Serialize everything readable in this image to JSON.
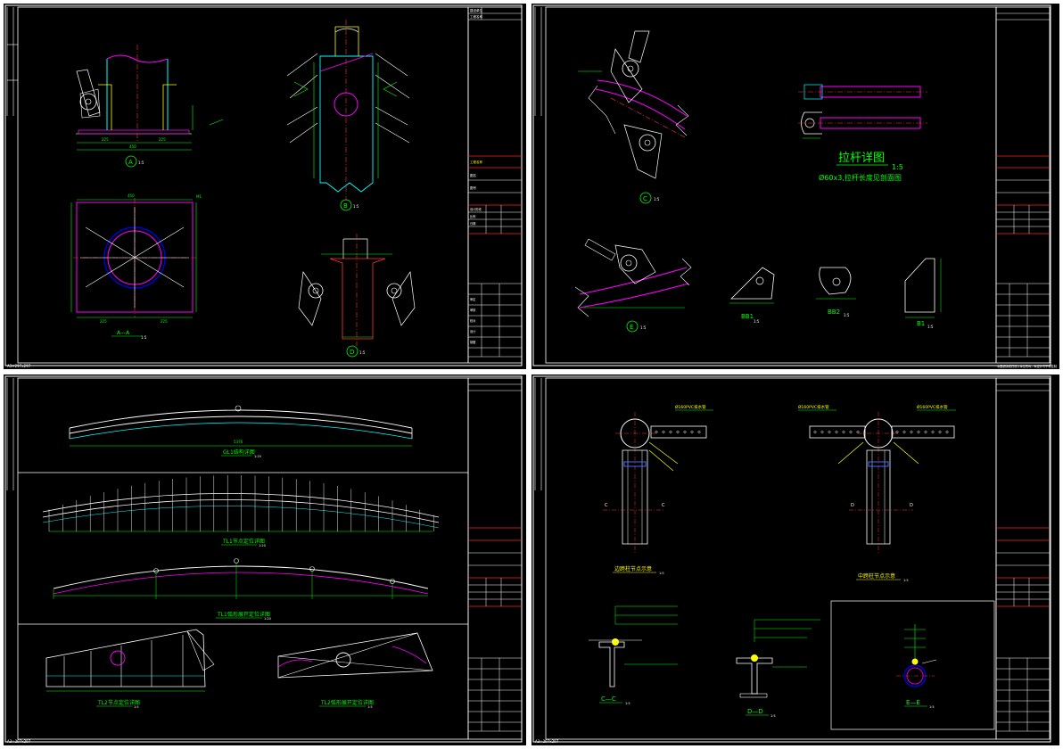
{
  "sheets": [
    {
      "id": "sheet-1",
      "labels": {
        "view_a": "A",
        "view_a_scale": "1:5",
        "view_aa": "A—A",
        "view_aa_scale": "1:5",
        "view_b": "B",
        "view_b_scale": "1:5",
        "view_d": "D",
        "view_d_scale": "1:5",
        "dim_225_left": "225",
        "dim_225_right": "225",
        "dim_450": "450",
        "dim_450_top": "450",
        "plate_m1": "M1"
      }
    },
    {
      "id": "sheet-2",
      "labels": {
        "rod_title": "拉杆详图",
        "rod_scale": "1:5",
        "rod_note": "Ø60x3,拉杆长度见剖面图",
        "view_c": "C",
        "view_c_scale": "1:5",
        "view_e": "E",
        "view_e_scale": "1:5",
        "bb1": "BB1",
        "bb1_scale": "1:5",
        "bb2": "BB2",
        "bb2_scale": "1:5",
        "b1": "B1",
        "b1_scale": "1:5"
      }
    },
    {
      "id": "sheet-3",
      "labels": {
        "gl_title": "GL1结构详图",
        "gl_scale": "1:20",
        "gl_dim": "5376",
        "tl1_title": "TL1节点定位详图",
        "tl1_scale": "1:20",
        "tl1_unfold": "TL1弧形展开定位详图",
        "tl1_unfold_scale": "1:20",
        "tl2_title": "TL2节点定位详图",
        "tl2_scale": "1:5",
        "tl2_unfold": "TL2弧形展开定位详图",
        "tl2_unfold_scale": "1:5"
      }
    },
    {
      "id": "sheet-4",
      "labels": {
        "pvc_left": "Ø160PVC排水管",
        "pvc_right_a": "Ø160PVC排水管",
        "pvc_right_b": "Ø160PVC排水管",
        "left_title": "边跨柱节点示意",
        "left_scale": "1:5",
        "right_title": "中跨柱节点示意",
        "right_scale": "1:5",
        "cc": "C—C",
        "cc_scale": "1:5",
        "dd": "D—D",
        "dd_scale": "1:5",
        "ee": "E—E",
        "ee_scale": "1:5"
      }
    }
  ],
  "title_block": {
    "rows_top": [
      "建设单位",
      "工程名称"
    ],
    "rows_mid": [
      "工程名称",
      "图名",
      "图号"
    ],
    "rows_low": [
      "设计阶段",
      "比例",
      "日期"
    ],
    "rows_sign": [
      "审定",
      "审核",
      "校对",
      "设计",
      "制图"
    ]
  },
  "footer": {
    "left": "A3+297x297",
    "right": "本图纸版权归设计单位所有，未经许可不得复制"
  },
  "colors": {
    "background": "#000000",
    "frame": "#ffffff",
    "title_block_accent": "#ff2a2a",
    "dimension": "#00ff00",
    "steel": "#ff00ff",
    "centerline": "#ff3b3b",
    "cyan": "#00ffff",
    "yellow": "#ffff00",
    "blue": "#3b6bff"
  }
}
